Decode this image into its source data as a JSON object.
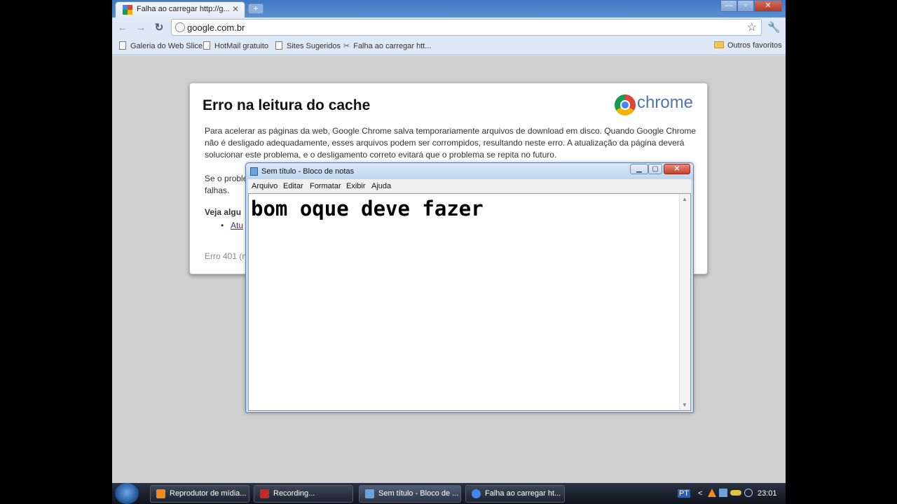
{
  "browser": {
    "tab_title": "Falha ao carregar http://g...",
    "tab_close": "✕",
    "new_tab": "+",
    "win_minimize": "—",
    "win_maximize": "▫",
    "win_close": "✕",
    "address": "google.com.br",
    "bookmarks": [
      {
        "label": "Galeria do Web Slice"
      },
      {
        "label": "HotMail gratuito"
      },
      {
        "label": "Sites Sugeridos"
      },
      {
        "label": "Falha ao carregar htt..."
      }
    ],
    "other_bookmarks": "Outros favoritos"
  },
  "error_page": {
    "title": "Erro na leitura do cache",
    "brand": "chrome",
    "paragraph1": "Para acelerar as páginas da web, Google Chrome salva temporariamente arquivos de download em disco. Quando Google Chrome não é desligado adequadamente, esses arquivos podem ser corrompidos, resultando neste erro. A atualização da página deverá solucionar este problema, e o desligamento correto evitará que o problema se repita no futuro.",
    "paragraph2_start": "Se o proble",
    "paragraph2_line2": "falhas.",
    "see_also": "Veja algu",
    "bullet": "•",
    "link_partial": "Atu",
    "error_code": "Erro 401 (n"
  },
  "notepad": {
    "title": "Sem título - Bloco de notas",
    "btn_min": "▁",
    "btn_max": "▢",
    "btn_close": "✕",
    "menus": [
      "Arquivo",
      "Editar",
      "Formatar",
      "Exibir",
      "Ajuda"
    ],
    "content": "bom oque deve fazer",
    "scroll_up": "▲",
    "scroll_down": "▼"
  },
  "taskbar": {
    "items": [
      {
        "label": "Reprodutor de mídia...",
        "icon_color": "#f08a1c"
      },
      {
        "label": "Recording...",
        "icon_color": "#c62828"
      },
      {
        "label": "Sem título - Bloco de ...",
        "icon_color": "#6aa2dc"
      },
      {
        "label": "Falha ao carregar ht...",
        "icon_color": "#4285f4"
      }
    ],
    "lang": "PT",
    "tray_arrow": "<",
    "clock": "23:01"
  }
}
